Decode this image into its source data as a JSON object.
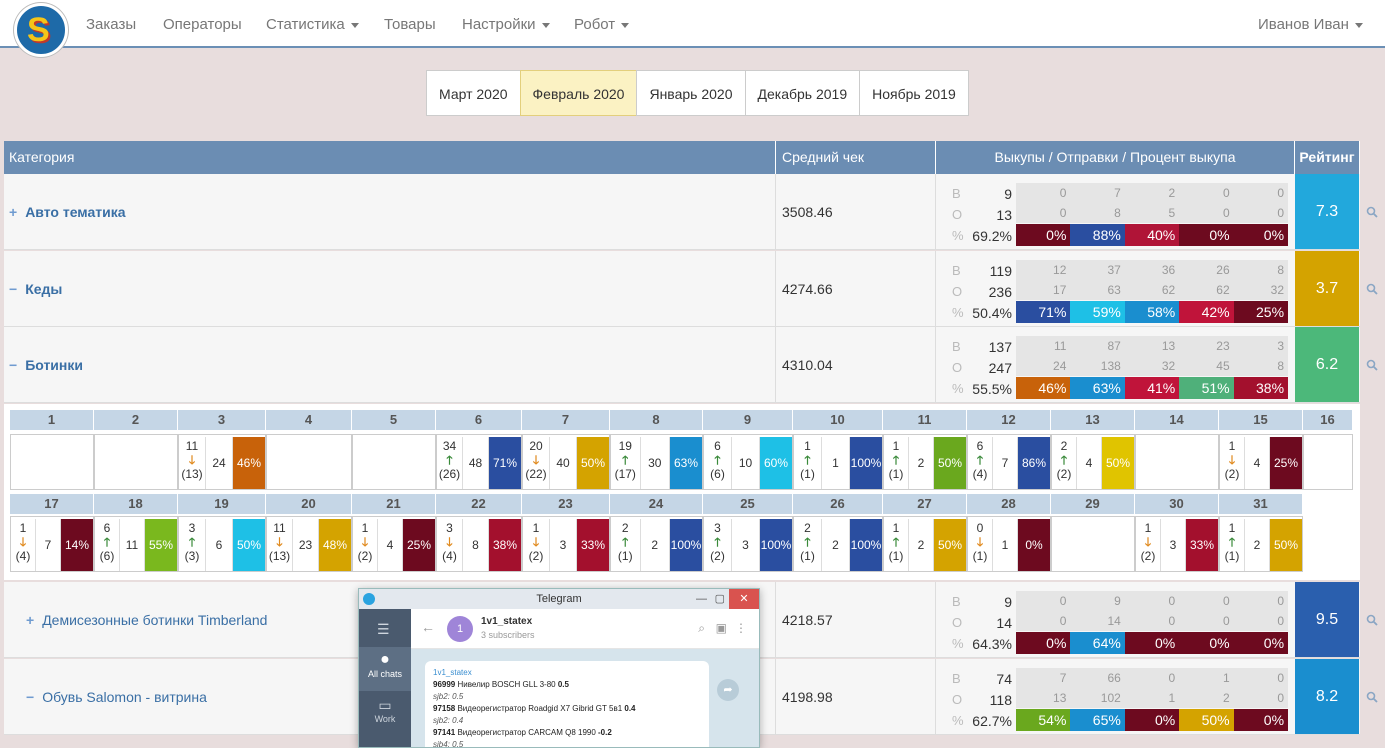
{
  "nav": {
    "logo_letter": "S",
    "items": [
      "Заказы",
      "Операторы",
      "Статистика",
      "Товары",
      "Настройки",
      "Робот"
    ],
    "dropdowns": [
      false,
      false,
      true,
      false,
      true,
      true
    ],
    "user": "Иванов Иван"
  },
  "months": [
    "Март 2020",
    "Февраль 2020",
    "Январь 2020",
    "Декабрь 2019",
    "Ноябрь 2019"
  ],
  "active_month": "Февраль 2020",
  "table": {
    "headers": {
      "category": "Категория",
      "avg": "Средний чек",
      "buyouts": "Выкупы / Отправки / Процент выкупа",
      "rating": "Рейтинг"
    },
    "labels": {
      "b": "В",
      "o": "О",
      "p": "%"
    },
    "rows": [
      {
        "name": "Авто тематика",
        "sign": "+",
        "avg": "3508.46",
        "b": "9",
        "o": "13",
        "p": "69.2%",
        "gb": [
          "0",
          "7",
          "2",
          "0",
          "0"
        ],
        "go": [
          "0",
          "8",
          "5",
          "0",
          "0"
        ],
        "pcts": [
          "0%",
          "88%",
          "40%",
          "0%",
          "0%"
        ],
        "colors": [
          "#6d0a1f",
          "#2a4ea0",
          "#b01437",
          "#6d0a1f",
          "#6d0a1f"
        ],
        "rating": "7.3",
        "rcolor": "#22a8dc"
      },
      {
        "name": "Кеды",
        "sign": "−",
        "avg": "4274.66",
        "b": "119",
        "o": "236",
        "p": "50.4%",
        "gb": [
          "12",
          "37",
          "36",
          "26",
          "8"
        ],
        "go": [
          "17",
          "63",
          "62",
          "62",
          "32"
        ],
        "pcts": [
          "71%",
          "59%",
          "58%",
          "42%",
          "25%"
        ],
        "colors": [
          "#2a4ea0",
          "#1ec0e6",
          "#1a8ecf",
          "#c0143a",
          "#6d0a1f"
        ],
        "rating": "3.7",
        "rcolor": "#d4a300"
      },
      {
        "name": "Ботинки",
        "sign": "−",
        "avg": "4310.04",
        "b": "137",
        "o": "247",
        "p": "55.5%",
        "gb": [
          "11",
          "87",
          "13",
          "23",
          "3"
        ],
        "go": [
          "24",
          "138",
          "32",
          "45",
          "8"
        ],
        "pcts": [
          "46%",
          "63%",
          "41%",
          "51%",
          "38%"
        ],
        "colors": [
          "#c8620a",
          "#1a8ecf",
          "#c0143a",
          "#4fb07a",
          "#a3102d"
        ],
        "rating": "6.2",
        "rcolor": "#4cb87a"
      },
      {
        "name": "Демисезонные ботинки Timberland",
        "sign": "+",
        "avg": "4218.57",
        "b": "9",
        "o": "14",
        "p": "64.3%",
        "gb": [
          "0",
          "9",
          "0",
          "0",
          "0"
        ],
        "go": [
          "0",
          "14",
          "0",
          "0",
          "0"
        ],
        "pcts": [
          "0%",
          "64%",
          "0%",
          "0%",
          "0%"
        ],
        "colors": [
          "#6d0a1f",
          "#1a8ecf",
          "#6d0a1f",
          "#6d0a1f",
          "#6d0a1f"
        ],
        "rating": "9.5",
        "rcolor": "#2a5fae"
      },
      {
        "name": "Обувь Salomon - витрина",
        "sign": "−",
        "avg": "4198.98",
        "b": "74",
        "o": "118",
        "p": "62.7%",
        "gb": [
          "7",
          "66",
          "0",
          "1",
          "0"
        ],
        "go": [
          "13",
          "102",
          "1",
          "2",
          "0"
        ],
        "pcts": [
          "54%",
          "65%",
          "0%",
          "50%",
          "0%"
        ],
        "colors": [
          "#6aa81e",
          "#1a8ecf",
          "#6d0a1f",
          "#d4a300",
          "#6d0a1f"
        ],
        "rating": "8.2",
        "rcolor": "#1a8ecf"
      }
    ]
  },
  "days_row1": [
    {
      "d": "1"
    },
    {
      "d": "2"
    },
    {
      "d": "3",
      "a": "11",
      "dir": "down",
      "prev": "(13)",
      "b": "24",
      "p": "46%",
      "c": "#c8620a"
    },
    {
      "d": "4"
    },
    {
      "d": "5"
    },
    {
      "d": "6",
      "a": "34",
      "dir": "up",
      "prev": "(26)",
      "b": "48",
      "p": "71%",
      "c": "#2a4ea0"
    },
    {
      "d": "7",
      "a": "20",
      "dir": "down",
      "prev": "(22)",
      "b": "40",
      "p": "50%",
      "c": "#d4a300"
    },
    {
      "d": "8",
      "a": "19",
      "dir": "up",
      "prev": "(17)",
      "b": "30",
      "p": "63%",
      "c": "#1a8ecf"
    },
    {
      "d": "9",
      "a": "6",
      "dir": "up",
      "prev": "(6)",
      "b": "10",
      "p": "60%",
      "c": "#1ec0e6"
    },
    {
      "d": "10",
      "a": "1",
      "dir": "up",
      "prev": "(1)",
      "b": "1",
      "p": "100%",
      "c": "#2a4ea0"
    },
    {
      "d": "11",
      "a": "1",
      "dir": "up",
      "prev": "(1)",
      "b": "2",
      "p": "50%",
      "c": "#6aa81e"
    },
    {
      "d": "12",
      "a": "6",
      "dir": "up",
      "prev": "(4)",
      "b": "7",
      "p": "86%",
      "c": "#2a4ea0"
    },
    {
      "d": "13",
      "a": "2",
      "dir": "up",
      "prev": "(2)",
      "b": "4",
      "p": "50%",
      "c": "#e0c400"
    },
    {
      "d": "14"
    },
    {
      "d": "15",
      "a": "1",
      "dir": "down",
      "prev": "(2)",
      "b": "4",
      "p": "25%",
      "c": "#6d0a1f"
    },
    {
      "d": "16"
    }
  ],
  "days_row2": [
    {
      "d": "17",
      "a": "1",
      "dir": "down",
      "prev": "(4)",
      "b": "7",
      "p": "14%",
      "c": "#6d0a1f"
    },
    {
      "d": "18",
      "a": "6",
      "dir": "up",
      "prev": "(6)",
      "b": "11",
      "p": "55%",
      "c": "#7ab81e"
    },
    {
      "d": "19",
      "a": "3",
      "dir": "up",
      "prev": "(3)",
      "b": "6",
      "p": "50%",
      "c": "#1ec0e6"
    },
    {
      "d": "20",
      "a": "11",
      "dir": "down",
      "prev": "(13)",
      "b": "23",
      "p": "48%",
      "c": "#d4a300"
    },
    {
      "d": "21",
      "a": "1",
      "dir": "down",
      "prev": "(2)",
      "b": "4",
      "p": "25%",
      "c": "#6d0a1f"
    },
    {
      "d": "22",
      "a": "3",
      "dir": "down",
      "prev": "(4)",
      "b": "8",
      "p": "38%",
      "c": "#a3102d"
    },
    {
      "d": "23",
      "a": "1",
      "dir": "down",
      "prev": "(2)",
      "b": "3",
      "p": "33%",
      "c": "#a3102d"
    },
    {
      "d": "24",
      "a": "2",
      "dir": "up",
      "prev": "(1)",
      "b": "2",
      "p": "100%",
      "c": "#2a4ea0"
    },
    {
      "d": "25",
      "a": "3",
      "dir": "up",
      "prev": "(2)",
      "b": "3",
      "p": "100%",
      "c": "#2a4ea0"
    },
    {
      "d": "26",
      "a": "2",
      "dir": "up",
      "prev": "(1)",
      "b": "2",
      "p": "100%",
      "c": "#2a4ea0"
    },
    {
      "d": "27",
      "a": "1",
      "dir": "up",
      "prev": "(1)",
      "b": "2",
      "p": "50%",
      "c": "#d4a300"
    },
    {
      "d": "28",
      "a": "0",
      "dir": "down",
      "prev": "(1)",
      "b": "1",
      "p": "0%",
      "c": "#6d0a1f"
    },
    {
      "d": "29"
    },
    {
      "d": "30",
      "a": "1",
      "dir": "down",
      "prev": "(2)",
      "b": "3",
      "p": "33%",
      "c": "#a3102d"
    },
    {
      "d": "31",
      "a": "1",
      "dir": "up",
      "prev": "(1)",
      "b": "2",
      "p": "50%",
      "c": "#d4a300"
    }
  ],
  "telegram": {
    "window_title": "Telegram",
    "channel": "1v1_statex",
    "subscribers": "3 subscribers",
    "avatar": "1",
    "side_items": [
      "All chats",
      "Work"
    ],
    "msg_sender": "1v1_statex",
    "msg_lines": [
      {
        "id": "96999",
        "text": " Нивелир BOSCH GLL 3-80 ",
        "val": "0.5"
      },
      {
        "sub": "sjb2: 0.5"
      },
      {
        "id": "97158",
        "text": " Видеорегистратор Roadgid X7 Gibrid GT 5в1 ",
        "val": "0.4"
      },
      {
        "sub": "sjb2: 0.4"
      },
      {
        "id": "97141",
        "text": " Видеорегистратор CARCAM Q8 1990 ",
        "val": "-0.2"
      },
      {
        "sub": "sjb4: 0.5"
      }
    ]
  }
}
